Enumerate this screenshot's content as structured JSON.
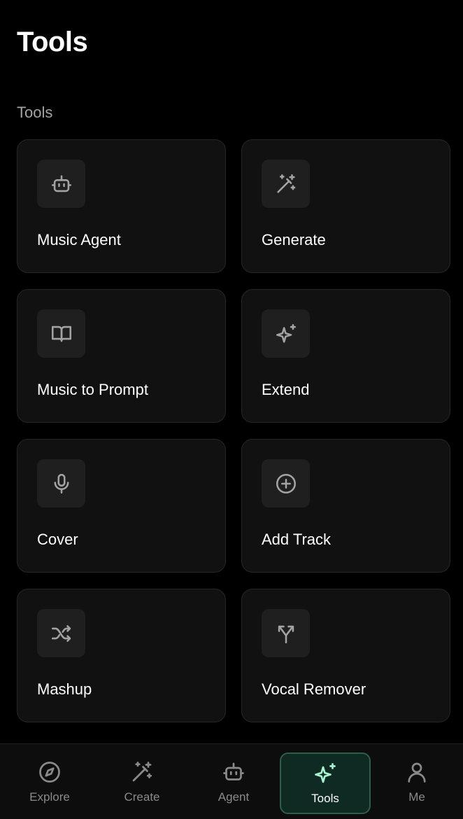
{
  "header": {
    "title": "Tools"
  },
  "section": {
    "label": "Tools"
  },
  "tools": [
    {
      "label": "Music Agent",
      "icon": "robot-icon"
    },
    {
      "label": "Generate",
      "icon": "magic-wand-icon"
    },
    {
      "label": "Music to Prompt",
      "icon": "book-icon"
    },
    {
      "label": "Extend",
      "icon": "sparkles-icon"
    },
    {
      "label": "Cover",
      "icon": "microphone-icon"
    },
    {
      "label": "Add Track",
      "icon": "plus-circle-icon"
    },
    {
      "label": "Mashup",
      "icon": "shuffle-icon"
    },
    {
      "label": "Vocal Remover",
      "icon": "split-arrows-icon"
    }
  ],
  "nav": {
    "items": [
      {
        "label": "Explore",
        "icon": "compass-icon"
      },
      {
        "label": "Create",
        "icon": "magic-wand-icon"
      },
      {
        "label": "Agent",
        "icon": "robot-icon"
      },
      {
        "label": "Tools",
        "icon": "sparkles-icon",
        "active": true
      },
      {
        "label": "Me",
        "icon": "user-icon"
      }
    ]
  },
  "colors": {
    "background": "#000000",
    "card": "#111111",
    "active_nav_bg": "#0f2a22",
    "active_nav_border": "#2c5e4b",
    "active_icon": "#a7f3d0"
  }
}
